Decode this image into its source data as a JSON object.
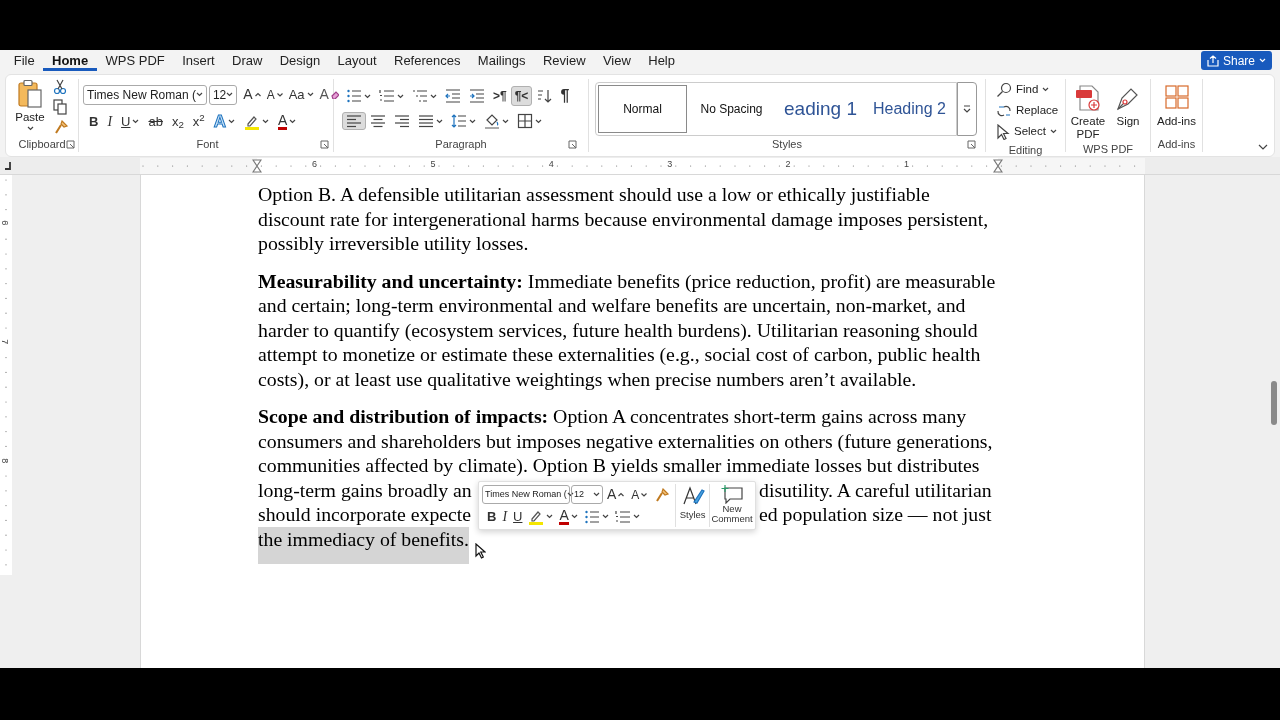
{
  "menu_tabs": [
    {
      "label": "File",
      "selected": false
    },
    {
      "label": "Home",
      "selected": true
    },
    {
      "label": "WPS PDF",
      "selected": false
    },
    {
      "label": "Insert",
      "selected": false
    },
    {
      "label": "Draw",
      "selected": false
    },
    {
      "label": "Design",
      "selected": false
    },
    {
      "label": "Layout",
      "selected": false
    },
    {
      "label": "References",
      "selected": false
    },
    {
      "label": "Mailings",
      "selected": false
    },
    {
      "label": "Review",
      "selected": false
    },
    {
      "label": "View",
      "selected": false
    },
    {
      "label": "Help",
      "selected": false
    }
  ],
  "share_button": {
    "label": "Share"
  },
  "ribbon": {
    "clipboard": {
      "paste_label": "Paste",
      "group_label": "Clipboard"
    },
    "font": {
      "font_name": "Times New Roman (",
      "font_size": "12",
      "row1": [
        {
          "kind": "grow",
          "label": "A"
        },
        {
          "kind": "shrink",
          "label": "A"
        },
        {
          "kind": "change_case",
          "label": "Aa",
          "dropdown": true
        },
        {
          "kind": "clear",
          "label": "A"
        }
      ],
      "row2": [
        {
          "kind": "bold",
          "label": "B"
        },
        {
          "kind": "italic",
          "label": "I"
        },
        {
          "kind": "underline",
          "label": "U",
          "dropdown": true
        },
        {
          "kind": "strike",
          "label": "ab"
        },
        {
          "kind": "subscript",
          "label": "x$_{2}$"
        },
        {
          "kind": "superscript",
          "label": "x$^{2}$"
        },
        {
          "kind": "text_effects",
          "label": "A",
          "dropdown": true
        },
        {
          "kind": "highlight",
          "dropdown": true
        },
        {
          "kind": "font_color",
          "label": "A",
          "dropdown": true
        }
      ],
      "group_label": "Font"
    },
    "paragraph": {
      "row1": [
        {
          "kind": "bullets",
          "dropdown": true,
          "selected": false
        },
        {
          "kind": "numbering",
          "dropdown": true,
          "selected": false
        },
        {
          "kind": "multilevel",
          "dropdown": true,
          "selected": false
        },
        {
          "kind": "decrease_indent",
          "selected": false
        },
        {
          "kind": "increase_indent",
          "selected": false
        },
        {
          "kind": "ltr",
          "label": ">¶",
          "selected": false
        },
        {
          "kind": "rtl",
          "label": "¶<",
          "selected": true
        },
        {
          "kind": "sort",
          "selected": false
        },
        {
          "kind": "show_marks",
          "label": "¶",
          "selected": false
        }
      ],
      "row2": [
        {
          "kind": "align_left",
          "selected": true
        },
        {
          "kind": "align_center",
          "selected": false
        },
        {
          "kind": "align_right",
          "selected": false
        },
        {
          "kind": "justify",
          "dropdown": true,
          "selected": false
        },
        {
          "kind": "line_spacing",
          "dropdown": true,
          "selected": false
        },
        {
          "kind": "shading",
          "dropdown": true,
          "selected": false
        },
        {
          "kind": "borders",
          "dropdown": true,
          "selected": false
        }
      ],
      "group_label": "Paragraph"
    },
    "styles": {
      "items": [
        {
          "label": "Normal",
          "kind": "body",
          "selected": true
        },
        {
          "label": "No Spacing",
          "kind": "body",
          "selected": false
        },
        {
          "label": "eading 1",
          "kind": "heading1",
          "selected": false
        },
        {
          "label": "Heading 2",
          "kind": "heading2",
          "selected": false
        }
      ],
      "group_label": "Styles"
    },
    "editing": {
      "items": [
        {
          "kind": "find",
          "label": "Find",
          "dropdown": true
        },
        {
          "kind": "replace",
          "label": "Replace"
        },
        {
          "kind": "select",
          "label": "Select",
          "dropdown": true
        }
      ],
      "group_label": "Editing"
    },
    "wps_pdf": {
      "buttons": [
        {
          "kind": "create_pdf",
          "label": "Create PDF"
        },
        {
          "kind": "sign",
          "label": "Sign"
        }
      ],
      "group_label": "WPS PDF"
    },
    "add_ins": {
      "label": "Add-ins",
      "group_label": "Add-ins"
    }
  },
  "rulers": {
    "horizontal": [
      "6",
      "5",
      "4",
      "3",
      "2",
      "1"
    ],
    "vertical": [
      "6",
      "7",
      "8"
    ]
  },
  "document": {
    "paragraphs": [
      {
        "lines": [
          {
            "text": "Option B. A defensible utilitarian assessment should use a low or ethically justifiable",
            "selected": false
          },
          {
            "text": "discount rate for intergenerational harms because environmental damage imposes persistent,",
            "selected": false
          },
          {
            "text": "possibly irreversible utility losses.",
            "selected": false
          }
        ]
      },
      {
        "lines": [
          {
            "text": "**Measurability and uncertainty:** Immediate benefits (price reduction, profit) are measurable",
            "selected": false
          },
          {
            "text": "and certain; long-term environmental and welfare benefits are uncertain, non-market, and",
            "selected": false
          },
          {
            "text": "harder to quantify (ecosystem services, future health burdens). Utilitarian reasoning should",
            "selected": false
          },
          {
            "text": "attempt to monetize or estimate these externalities (e.g., social cost of carbon, public health",
            "selected": false
          },
          {
            "text": "costs), or at least use qualitative weightings when precise numbers aren’t available.",
            "selected": false
          }
        ]
      },
      {
        "lines": [
          {
            "text": "**Scope and distribution of impacts:** Option A concentrates short-term gains across many",
            "selected": false
          },
          {
            "text": "consumers and shareholders but imposes negative externalities on others (future generations,",
            "selected": false
          },
          {
            "text": "communities affected by climate). Option B yields smaller immediate losses but distributes",
            "selected": false
          },
          {
            "segments": [
              "long-term gains broadly an",
              "disutility. A careful utilitarian"
            ],
            "selected": false
          },
          {
            "segments": [
              "should incorporate expecte",
              "ed population size — not just"
            ],
            "selected": false
          },
          {
            "text": "the immediacy of benefits.",
            "selected": true
          }
        ]
      }
    ]
  },
  "mini_toolbar": {
    "font_name": "Times New Roman (",
    "font_size": "12",
    "row1": [
      {
        "kind": "grow",
        "label": "A"
      },
      {
        "kind": "shrink",
        "label": "A"
      },
      {
        "kind": "format_painter"
      }
    ],
    "row2": [
      {
        "kind": "bold",
        "label": "B"
      },
      {
        "kind": "italic",
        "label": "I"
      },
      {
        "kind": "underline",
        "label": "U"
      },
      {
        "kind": "highlight",
        "dropdown": true
      },
      {
        "kind": "font_color",
        "label": "A",
        "dropdown": true
      },
      {
        "kind": "bullets",
        "dropdown": true
      },
      {
        "kind": "numbering",
        "dropdown": true
      }
    ],
    "styles_label": "Styles",
    "comment_label": "New Comment"
  }
}
